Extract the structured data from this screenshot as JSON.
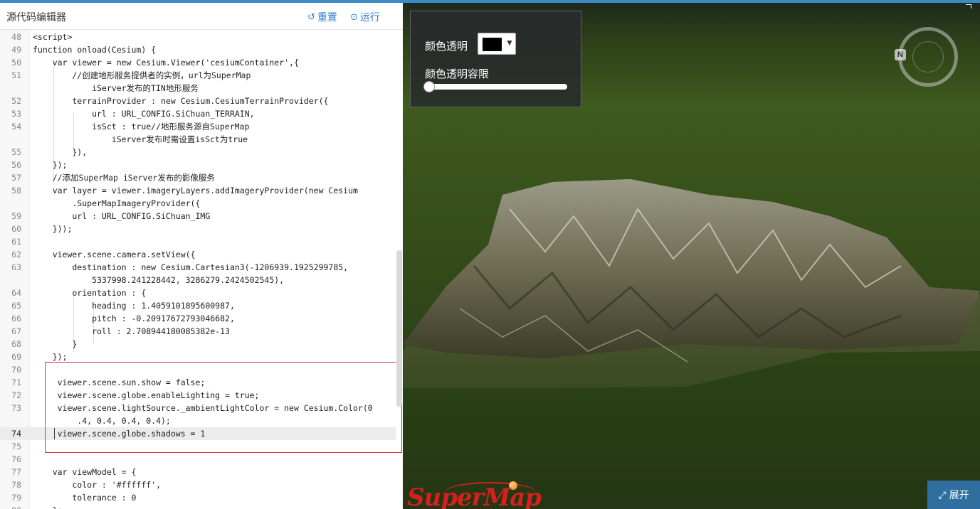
{
  "editor": {
    "title": "源代码编辑器",
    "reset_label": "重置",
    "run_label": "运行",
    "lines": [
      {
        "n": "48",
        "text": "<script>",
        "indent": 0
      },
      {
        "n": "49",
        "text": "function onload(Cesium) {",
        "indent": 0
      },
      {
        "n": "50",
        "text": "    var viewer = new Cesium.Viewer('cesiumContainer',{",
        "indent": 0
      },
      {
        "n": "51",
        "text": "        //创建地形服务提供者的实例，url为SuperMap",
        "indent": 0
      },
      {
        "n": "",
        "text": "            iServer发布的TIN地形服务",
        "indent": 0
      },
      {
        "n": "52",
        "text": "        terrainProvider : new Cesium.CesiumTerrainProvider({",
        "indent": 0
      },
      {
        "n": "53",
        "text": "            url : URL_CONFIG.SiChuan_TERRAIN,",
        "indent": 0
      },
      {
        "n": "54",
        "text": "            isSct : true//地形服务源自SuperMap",
        "indent": 0
      },
      {
        "n": "",
        "text": "                iServer发布时需设置isSct为true",
        "indent": 0
      },
      {
        "n": "55",
        "text": "        }),",
        "indent": 0
      },
      {
        "n": "56",
        "text": "    });",
        "indent": 0
      },
      {
        "n": "57",
        "text": "    //添加SuperMap iServer发布的影像服务",
        "indent": 0
      },
      {
        "n": "58",
        "text": "    var layer = viewer.imageryLayers.addImageryProvider(new Cesium",
        "indent": 0
      },
      {
        "n": "",
        "text": "        .SuperMapImageryProvider({",
        "indent": 0
      },
      {
        "n": "59",
        "text": "        url : URL_CONFIG.SiChuan_IMG",
        "indent": 0
      },
      {
        "n": "60",
        "text": "    }));",
        "indent": 0
      },
      {
        "n": "61",
        "text": "",
        "indent": 0
      },
      {
        "n": "62",
        "text": "    viewer.scene.camera.setView({",
        "indent": 0
      },
      {
        "n": "63",
        "text": "        destination : new Cesium.Cartesian3(-1206939.1925299785,",
        "indent": 0
      },
      {
        "n": "",
        "text": "            5337998.241228442, 3286279.2424502545),",
        "indent": 0
      },
      {
        "n": "64",
        "text": "        orientation : {",
        "indent": 0
      },
      {
        "n": "65",
        "text": "            heading : 1.4059101895600987,",
        "indent": 0
      },
      {
        "n": "66",
        "text": "            pitch : -0.20917672793046682,",
        "indent": 0
      },
      {
        "n": "67",
        "text": "            roll : 2.708944180085382e-13",
        "indent": 0
      },
      {
        "n": "68",
        "text": "        }",
        "indent": 0
      },
      {
        "n": "69",
        "text": "    });",
        "indent": 0
      },
      {
        "n": "70",
        "text": "",
        "indent": 0
      },
      {
        "n": "71",
        "text": "     viewer.scene.sun.show = false;",
        "indent": 0
      },
      {
        "n": "72",
        "text": "     viewer.scene.globe.enableLighting = true;",
        "indent": 0
      },
      {
        "n": "73",
        "text": "     viewer.scene.lightSource._ambientLightColor = new Cesium.Color(0",
        "indent": 0
      },
      {
        "n": "",
        "text": "         .4, 0.4, 0.4, 0.4);",
        "indent": 0
      },
      {
        "n": "74",
        "text": "     viewer.scene.globe.shadows = 1",
        "indent": 0,
        "active": true
      },
      {
        "n": "75",
        "text": "",
        "indent": 0
      },
      {
        "n": "76",
        "text": "",
        "indent": 0
      },
      {
        "n": "77",
        "text": "    var viewModel = {",
        "indent": 0
      },
      {
        "n": "78",
        "text": "        color : '#ffffff',",
        "indent": 0
      },
      {
        "n": "79",
        "text": "        tolerance : 0",
        "indent": 0
      },
      {
        "n": "80",
        "text": "    };",
        "indent": 0
      }
    ]
  },
  "control_panel": {
    "color_label": "颜色透明",
    "color_value": "#000000",
    "tolerance_label": "颜色透明容限",
    "tolerance_value": 0
  },
  "compass": {
    "north_label": "N"
  },
  "expand_button": {
    "label": "展开"
  },
  "logo": {
    "text": "SuperMap"
  },
  "colors": {
    "accent": "#2f7fd2",
    "highlight_border": "#d9363e",
    "expand_bg": "#2f6e9e"
  }
}
